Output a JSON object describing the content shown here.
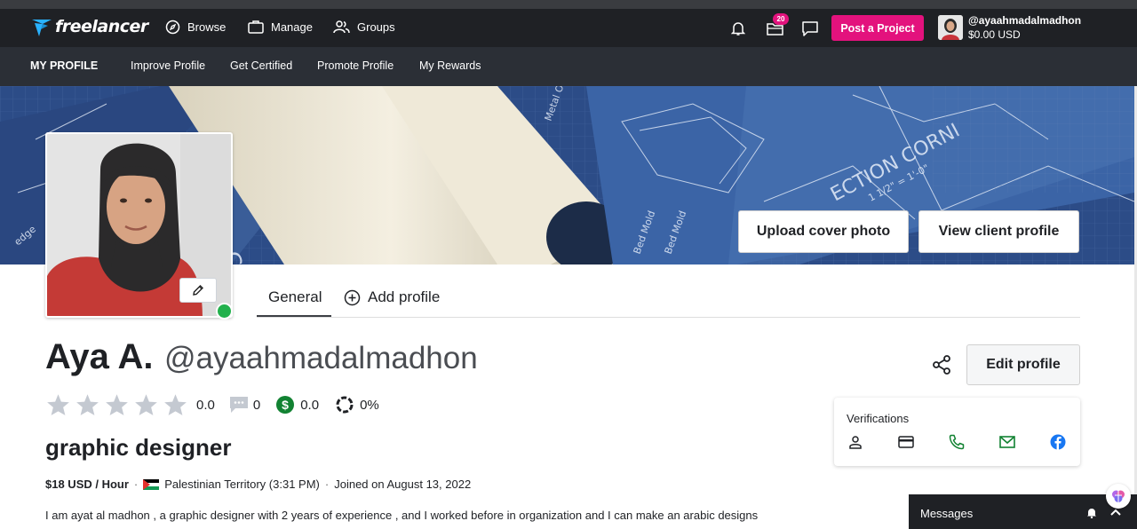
{
  "topnav": {
    "logo_text": "freelancer",
    "browse_label": "Browse",
    "manage_label": "Manage",
    "groups_label": "Groups",
    "notifications_badge": "20",
    "post_project_label": "Post a Project",
    "user_handle": "@ayaahmadalmadhon",
    "user_balance": "$0.00 USD",
    "accent_color": "#e3127d",
    "brand_color": "#29b2fe"
  },
  "subnav": {
    "items": [
      "MY PROFILE",
      "Improve Profile",
      "Get Certified",
      "Promote Profile",
      "My Rewards"
    ]
  },
  "cover": {
    "upload_label": "Upload cover photo",
    "view_client_label": "View client profile"
  },
  "tabs": {
    "general": "General",
    "add_profile": "Add profile"
  },
  "profile": {
    "name": "Aya A.",
    "handle": "@ayaahmadalmadhon",
    "rating": "0.0",
    "reviews": "0",
    "earnings_score": "0.0",
    "completion": "0%",
    "headline": "graphic designer",
    "rate": "$18 USD / Hour",
    "location": "Palestinian Territory (3:31 PM)",
    "joined": "Joined on August 13, 2022",
    "bio": "I am ayat al madhon , a graphic designer with 2 years of experience , and I worked before in organization and I can make an arabic designs",
    "online_color": "#22b14c"
  },
  "actions": {
    "edit_profile_label": "Edit profile"
  },
  "verifications": {
    "title": "Verifications",
    "items": [
      "identity-icon",
      "payment-card-icon",
      "phone-icon",
      "email-icon",
      "facebook-icon"
    ]
  },
  "messages": {
    "label": "Messages"
  }
}
